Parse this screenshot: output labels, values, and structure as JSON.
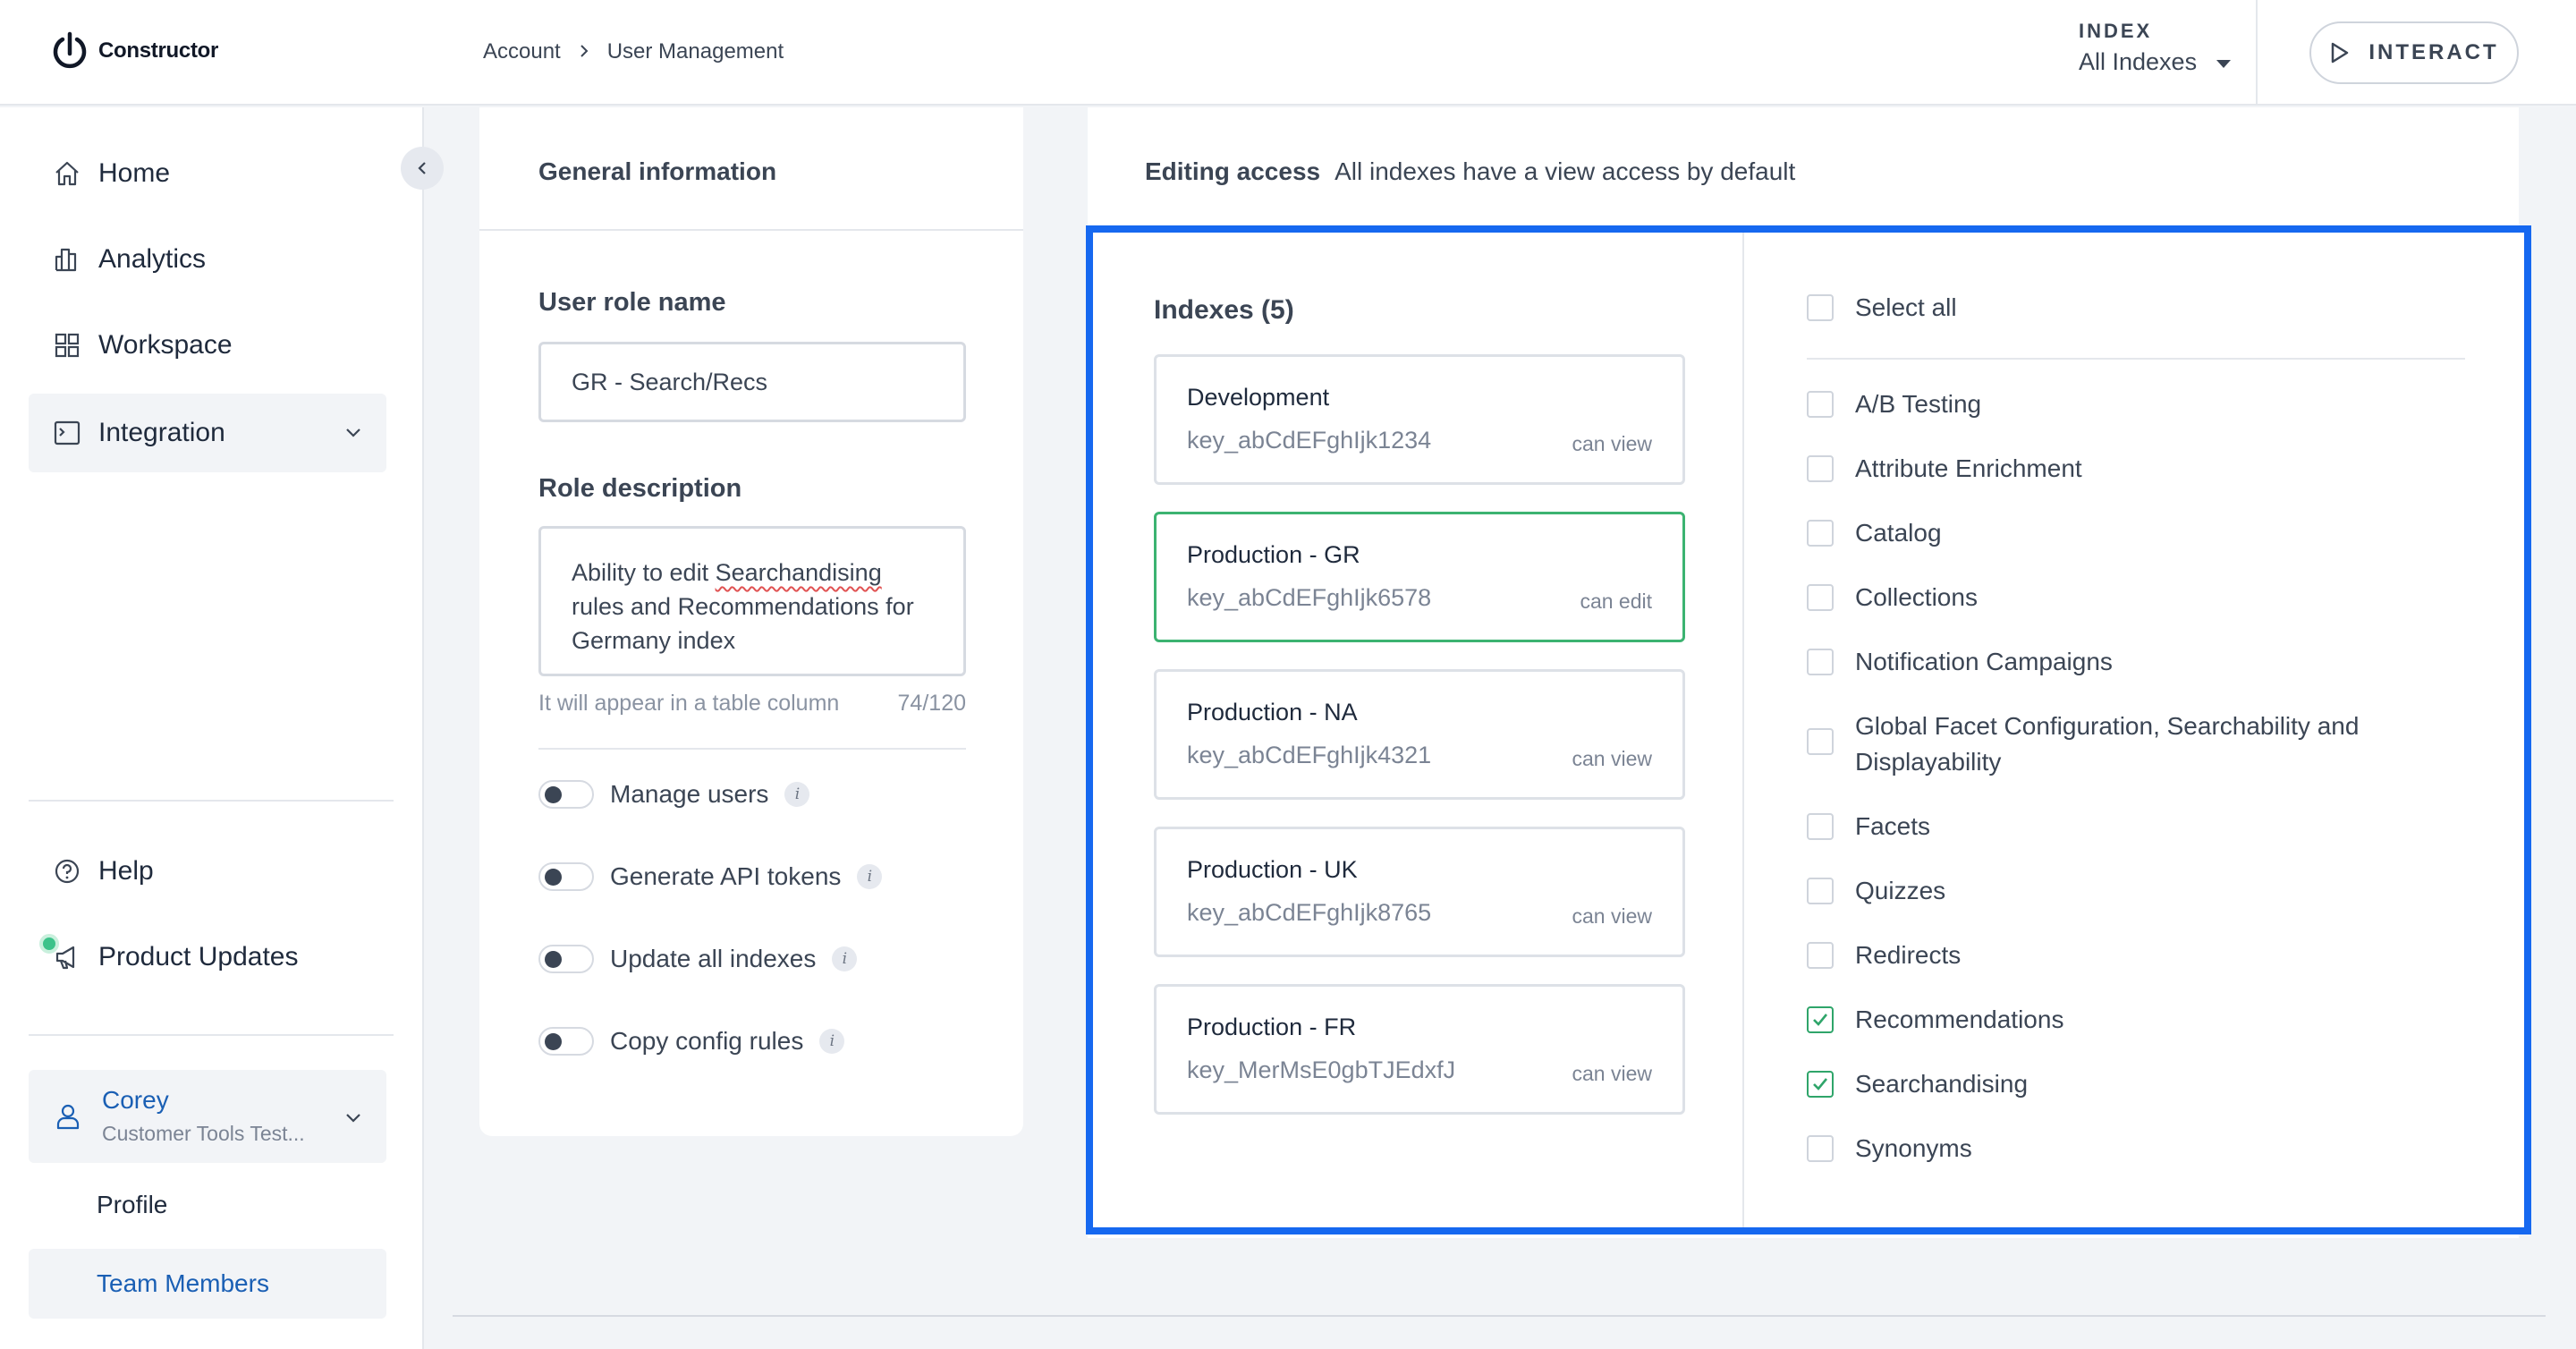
{
  "app": {
    "brand": "Constructor"
  },
  "breadcrumb": {
    "items": [
      "Account",
      "User Management"
    ]
  },
  "index_selector": {
    "label": "INDEX",
    "value": "All Indexes"
  },
  "interact_button": {
    "label": "INTERACT"
  },
  "sidebar": {
    "nav": [
      {
        "label": "Home",
        "icon": "home-icon"
      },
      {
        "label": "Analytics",
        "icon": "analytics-icon"
      },
      {
        "label": "Workspace",
        "icon": "workspace-icon"
      },
      {
        "label": "Integration",
        "icon": "integration-icon"
      }
    ],
    "help": {
      "label": "Help",
      "icon": "help-icon"
    },
    "product_updates": {
      "label": "Product Updates",
      "icon": "megaphone-icon"
    },
    "user": {
      "name": "Corey",
      "org": "Customer Tools Test..."
    },
    "user_menu": [
      "Profile",
      "Team Members"
    ],
    "active_sub_item": "Team Members"
  },
  "general_info": {
    "title": "General information",
    "role_name_label": "User role name",
    "role_name_value": "GR - Search/Recs",
    "role_desc_label": "Role description",
    "role_desc_parts": [
      "Ability to edit ",
      "Searchandising",
      " rules and Recommendations for Germany index"
    ],
    "hint": "It will appear in a table column",
    "char_count": "74/120",
    "toggles": [
      {
        "label": "Manage users",
        "on": false
      },
      {
        "label": "Generate API tokens",
        "on": false
      },
      {
        "label": "Update all indexes",
        "on": false
      },
      {
        "label": "Copy config rules",
        "on": false
      }
    ]
  },
  "editing_access": {
    "title": "Editing access",
    "subtitle": "All indexes have a view access by default",
    "indexes_title": "Indexes (5)",
    "indexes": [
      {
        "name": "Development",
        "key": "key_abCdEFghIjk1234",
        "permission": "can view",
        "selected": false
      },
      {
        "name": "Production - GR",
        "key": "key_abCdEFghIjk6578",
        "permission": "can edit",
        "selected": true
      },
      {
        "name": "Production - NA",
        "key": "key_abCdEFghIjk4321",
        "permission": "can view",
        "selected": false
      },
      {
        "name": "Production - UK",
        "key": "key_abCdEFghIjk8765",
        "permission": "can view",
        "selected": false
      },
      {
        "name": "Production - FR",
        "key": "key_MerMsE0gbTJEdxfJ",
        "permission": "can view",
        "selected": false
      }
    ],
    "select_all": {
      "label": "Select all",
      "checked": false
    },
    "permissions": [
      {
        "label": "A/B Testing",
        "checked": false
      },
      {
        "label": "Attribute Enrichment",
        "checked": false
      },
      {
        "label": "Catalog",
        "checked": false
      },
      {
        "label": "Collections",
        "checked": false
      },
      {
        "label": "Notification Campaigns",
        "checked": false
      },
      {
        "label": "Global Facet Configuration, Searchability and Displayability",
        "checked": false
      },
      {
        "label": "Facets",
        "checked": false
      },
      {
        "label": "Quizzes",
        "checked": false
      },
      {
        "label": "Redirects",
        "checked": false
      },
      {
        "label": "Recommendations",
        "checked": true
      },
      {
        "label": "Searchandising",
        "checked": true
      },
      {
        "label": "Synonyms",
        "checked": false
      }
    ]
  },
  "colors": {
    "accent": "#1a5fb4",
    "highlight_border": "#1668f0",
    "selected_index_border": "#3cb371",
    "check_green": "#2fa56a",
    "update_dot": "#3cc28a"
  }
}
